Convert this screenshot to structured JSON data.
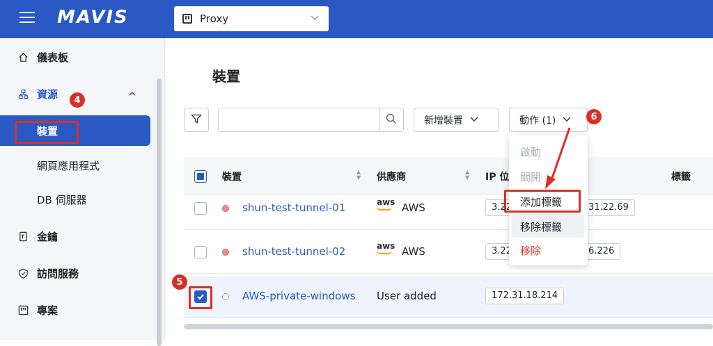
{
  "header": {
    "logo": "MAVIS",
    "project_icon": "project-icon",
    "project": "Proxy"
  },
  "sidebar": {
    "items": [
      {
        "label": "儀表板",
        "icon": "home-icon"
      },
      {
        "label": "資源",
        "icon": "sitemap-icon",
        "expanded": true
      },
      {
        "label": "裝置",
        "active": true
      },
      {
        "label": "網頁應用程式"
      },
      {
        "label": "DB 伺服器"
      },
      {
        "label": "金鑰",
        "icon": "key-icon"
      },
      {
        "label": "訪問服務",
        "icon": "shield-icon"
      },
      {
        "label": "專案",
        "icon": "project-icon"
      }
    ]
  },
  "page": {
    "title": "裝置"
  },
  "toolbar": {
    "search_placeholder": "",
    "add_device": "新增裝置",
    "actions": "動作 (1)"
  },
  "table": {
    "columns": [
      "裝置",
      "供應商",
      "IP 位",
      "標籤"
    ],
    "rows": [
      {
        "name": "shun-test-tunnel-01",
        "provider": "AWS",
        "ip_left": "3.22",
        "ip_right": "31.22.69",
        "status": "offline",
        "checked": false
      },
      {
        "name": "shun-test-tunnel-02",
        "provider": "AWS",
        "ip_left": "3.22",
        "ip_right": "6.226",
        "status": "offline",
        "checked": false
      },
      {
        "name": "AWS-private-windows",
        "provider": "User added",
        "ip": "172.31.18.214",
        "status": "unknown",
        "checked": true
      }
    ]
  },
  "dropdown": {
    "items": [
      {
        "label": "啟動",
        "disabled": true
      },
      {
        "label": "關閉",
        "disabled": true
      },
      {
        "label": "添加標籤"
      },
      {
        "label": "移除標籤"
      },
      {
        "label": "移除",
        "danger": true
      }
    ]
  },
  "annotations": {
    "step4": "4",
    "step5": "5",
    "step6": "6"
  },
  "colors": {
    "brand": "#2b59c3",
    "annotation": "#d93025"
  }
}
